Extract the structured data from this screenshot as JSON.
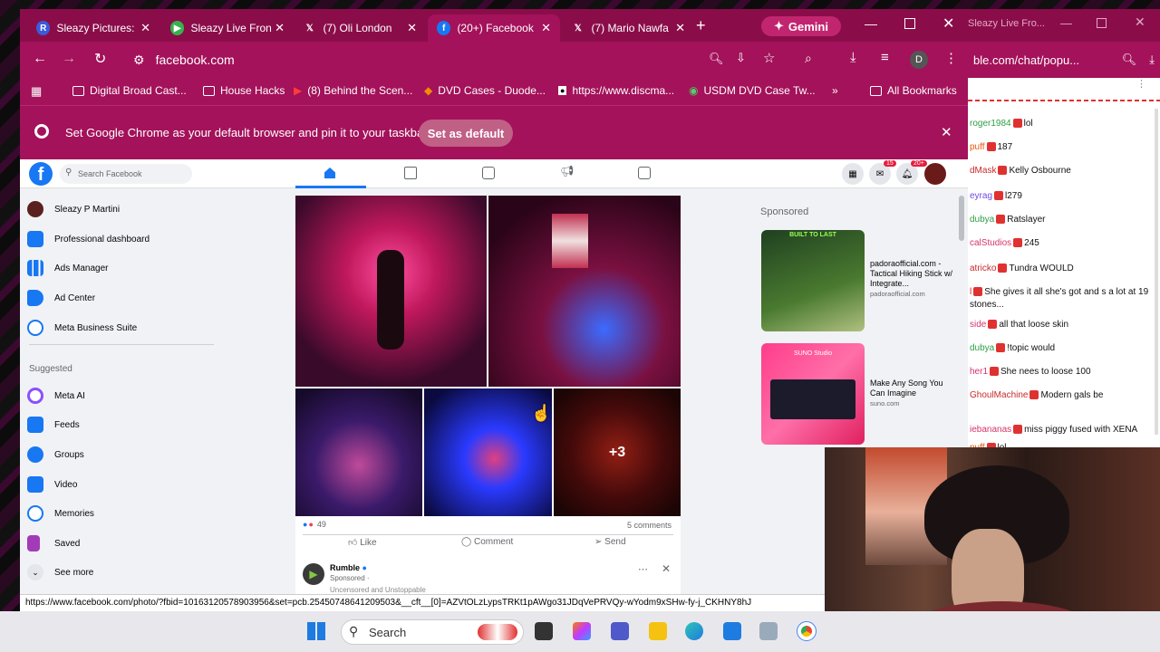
{
  "tabs": [
    {
      "label": "Sleazy Pictures:",
      "icon": "R",
      "color": "#3b5bdb"
    },
    {
      "label": "Sleazy Live Fron",
      "icon": "▶",
      "color": "#37b24d"
    },
    {
      "label": "(7) Oli London",
      "icon": "𝕏",
      "color": "#000"
    },
    {
      "label": "(20+) Facebook",
      "icon": "f",
      "color": "#1877f2"
    },
    {
      "label": "(7) Mario Nawfa",
      "icon": "𝕏",
      "color": "#000"
    }
  ],
  "gemini_label": "Gemini",
  "address": "facebook.com",
  "profile_initial": "D",
  "bookmarks": [
    {
      "label": "Digital Broad Cast..."
    },
    {
      "label": "House Hacks"
    },
    {
      "label": "(8) Behind the Scen..."
    },
    {
      "label": "DVD Cases - Duode..."
    },
    {
      "label": "https://www.discma..."
    },
    {
      "label": "USDM DVD Case Tw..."
    }
  ],
  "all_bookmarks": "All Bookmarks",
  "infobar": {
    "message": "Set Google Chrome as your default browser and pin it to your taskbar",
    "button": "Set as default"
  },
  "fb": {
    "search_placeholder": "Search Facebook",
    "messenger_badge": "15",
    "notif_badge": "20+",
    "sidebar": [
      {
        "label": "Sleazy P Martini",
        "color": "#5a2020"
      },
      {
        "label": "Professional dashboard",
        "color": "#1877f2"
      },
      {
        "label": "Ads Manager",
        "color": "#1877f2"
      },
      {
        "label": "Ad Center",
        "color": "#1877f2"
      },
      {
        "label": "Meta Business Suite",
        "color": "#1877f2"
      }
    ],
    "suggested_title": "Suggested",
    "suggested": [
      {
        "label": "Meta AI",
        "color": "#8a4fff"
      },
      {
        "label": "Feeds",
        "color": "#1877f2"
      },
      {
        "label": "Groups",
        "color": "#1877f2"
      },
      {
        "label": "Video",
        "color": "#1877f2"
      },
      {
        "label": "Memories",
        "color": "#1877f2"
      },
      {
        "label": "Saved",
        "color": "#a33bb8"
      }
    ],
    "see_more": "See more",
    "post": {
      "reaction_count": "49",
      "comments": "5 comments",
      "more_photos": "+3",
      "like": "Like",
      "comment": "Comment",
      "send": "Send"
    },
    "next_post": {
      "author": "Rumble",
      "sub": "Sponsored · ",
      "teaser": "Uncensored and Unstoppable"
    },
    "sponsored_title": "Sponsored",
    "ads": [
      {
        "title": "padoraofficial.com - Tactical Hiking Stick w/ Integrate...",
        "domain": "padoraofficial.com",
        "img_text": "BUILT TO LAST"
      },
      {
        "title": "Make Any Song You Can Imagine",
        "domain": "suno.com",
        "img_text": "SUNO Studio"
      }
    ]
  },
  "status_url": "https://www.facebook.com/photo/?fbid=10163120578903956&set=pcb.25450748641209503&__cft__[0]=AZVtOLzLypsTRKt1pAWgo31JDqVePRVQy-wYodm9xSHw-fy-j_CKHNY8hJ",
  "chat": {
    "url": "ble.com/chat/popu...",
    "title": "Sleazy Live Fro...",
    "messages": [
      {
        "user": "roger1984",
        "text": "lol",
        "color": "#2f9e44"
      },
      {
        "user": "puff",
        "text": "187",
        "color": "#e8590c"
      },
      {
        "user": "dMask",
        "text": "Kelly Osbourne",
        "color": "#c92a2a"
      },
      {
        "user": "eyrag",
        "text": "l279",
        "color": "#7048e8"
      },
      {
        "user": "dubya",
        "text": "Ratslayer",
        "color": "#2f9e44"
      },
      {
        "user": "calStudios",
        "text": "245",
        "color": "#d6336c"
      },
      {
        "user": "atricko",
        "text": "Tundra WOULD",
        "color": "#c92a2a"
      },
      {
        "user": "l",
        "text": "She gives it all she's got and s a lot at 19 stones...",
        "color": "#c92a2a"
      },
      {
        "user": "side",
        "text": "all that loose skin",
        "color": "#d6336c"
      },
      {
        "user": "dubya",
        "text": "!topic would",
        "color": "#2f9e44"
      },
      {
        "user": "her1",
        "text": "She nees to loose 100",
        "color": "#d6336c"
      },
      {
        "user": "GhoulMachine",
        "text": "Modern gals be",
        "color": "#c92a2a"
      },
      {
        "user": "iebananas",
        "text": "miss piggy fused with XENA",
        "color": "#d6336c"
      },
      {
        "user": "puff",
        "text": "lol",
        "color": "#e8590c"
      }
    ]
  },
  "taskbar": {
    "search": "Search"
  }
}
